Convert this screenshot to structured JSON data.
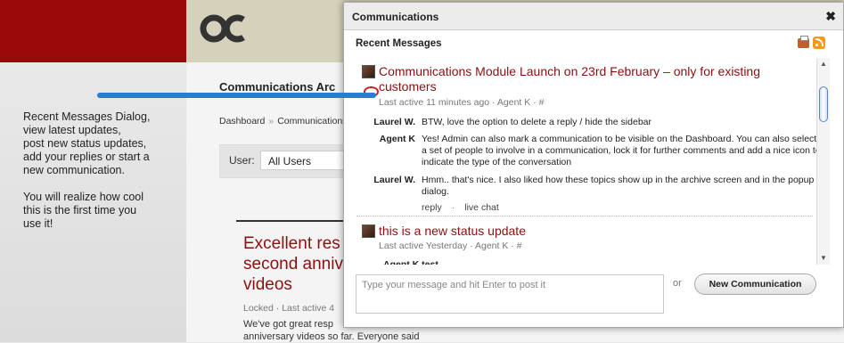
{
  "annotation": {
    "paragraph1": "Recent Messages Dialog,\nview latest updates,\npost new status updates,\nadd your replies or start a\nnew communication.",
    "paragraph2": "You will realize how cool\nthis is the first time you\nuse it!"
  },
  "background": {
    "heading": "Communications Arc",
    "breadcrumb": [
      "Dashboard",
      "Communications"
    ],
    "user_label": "User:",
    "user_value": "All Users",
    "post_title": "Excellent res\nsecond anniv\nvideos",
    "post_meta": "Locked · Last active 4",
    "post_body": "We've got great resp\nanniversary videos so far. Everyone said"
  },
  "dialog": {
    "title": "Communications",
    "close": "✖",
    "subtitle": "Recent Messages",
    "conversations": [
      {
        "title_line1": "Communications Module Launch on 23rd February – only for existing",
        "title_line2": "customers",
        "meta": "Last active 11 minutes ago · Agent K · #",
        "replies": [
          {
            "author": "Laurel W.",
            "text": "BTW, love the option to delete a reply / hide the sidebar"
          },
          {
            "author": "Agent K",
            "text": "Yes! Admin can also mark a communication to be visible on the Dashboard. You can also select a set of people to involve in a communication, lock it for further comments and add a nice icon to indicate the type of the conversation"
          },
          {
            "author": "Laurel W.",
            "text": "Hmm.. that's nice. I also liked how these topics show up in the archive screen and in the popup dialog."
          }
        ],
        "actions": {
          "reply": "reply",
          "sep": "·",
          "chat": "live chat"
        }
      },
      {
        "title_line1": "this is a new status update",
        "meta": "Last active Yesterday · Agent K · #",
        "cut_text": "Agent K test"
      }
    ],
    "composer_placeholder": "Type your message and hit Enter to post it",
    "or": "or",
    "new_button": "New Communication"
  },
  "colors": {
    "brand_red": "#9b0a0a",
    "title_red": "#8b1010",
    "arrow_blue": "#2a7ad6",
    "topbar_tan": "#d6d1ba"
  },
  "icons": [
    "close-icon",
    "print-icon",
    "rss-icon",
    "avatar",
    "chat-icon",
    "scroll-up-icon",
    "scroll-down-icon"
  ]
}
